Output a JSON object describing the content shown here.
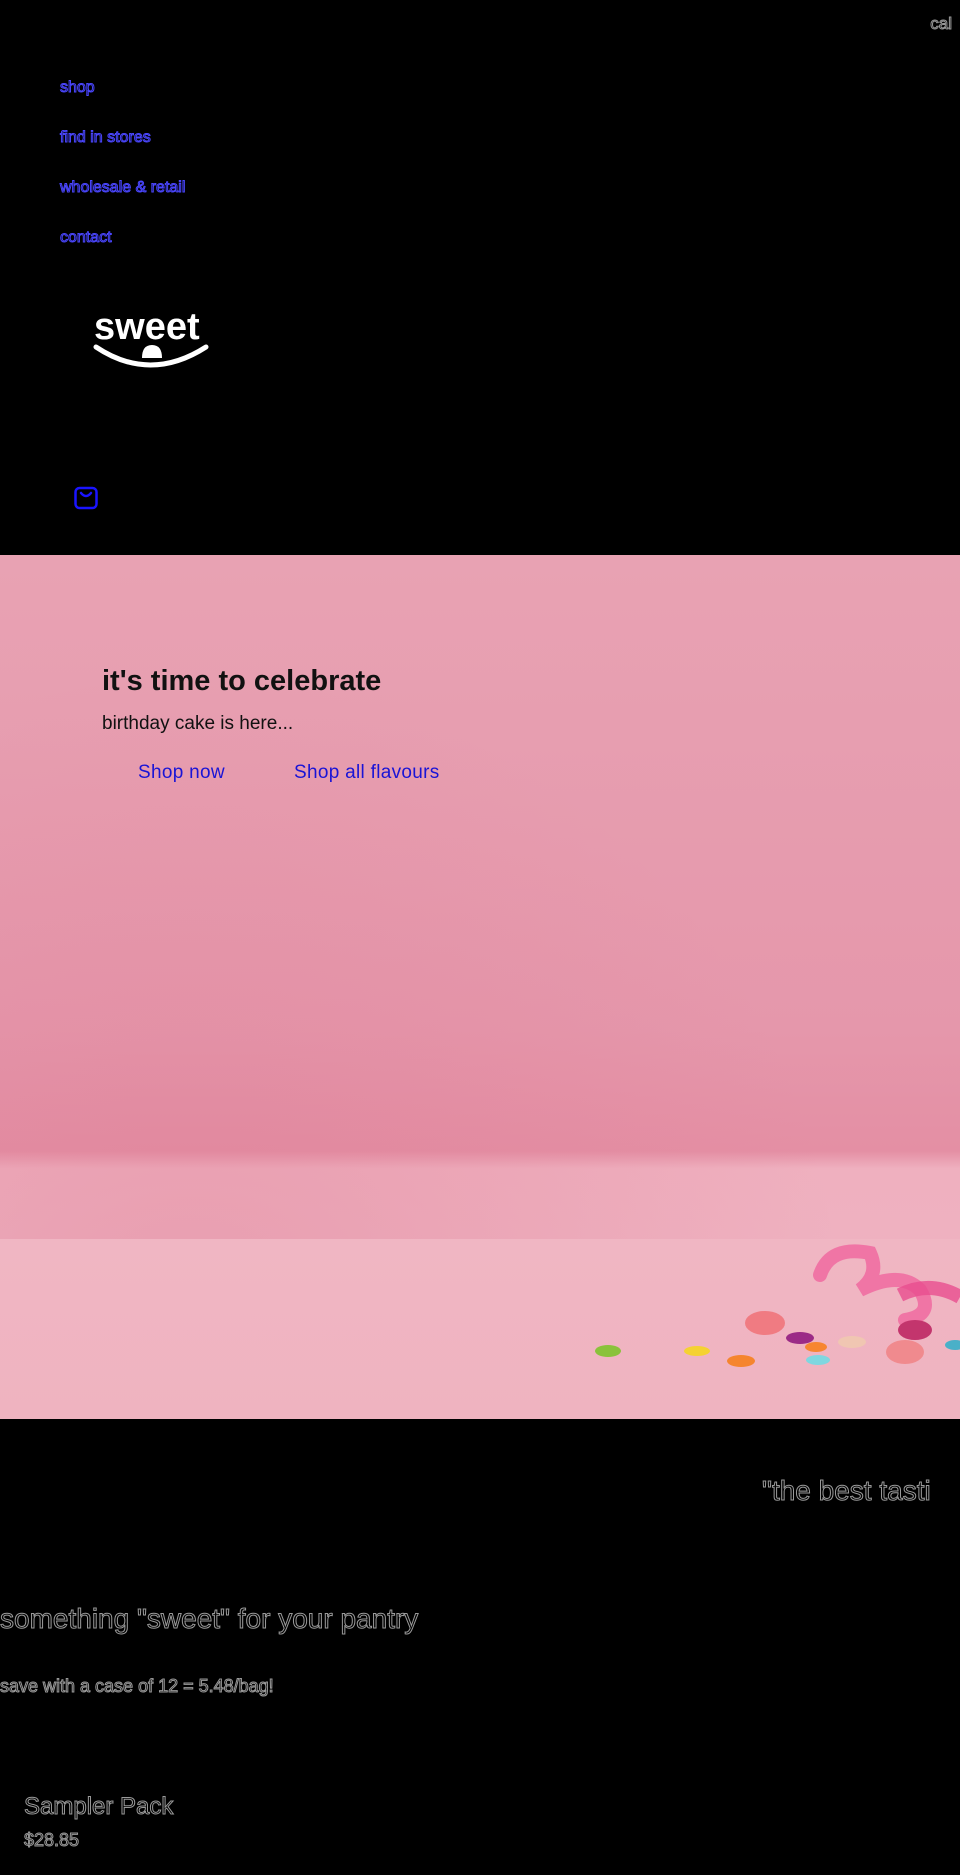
{
  "header": {
    "corner_text": "cal",
    "nav": [
      {
        "label": "shop"
      },
      {
        "label": "find in stores"
      },
      {
        "label": "wholesale & retail"
      },
      {
        "label": "contact"
      }
    ],
    "logo_text": "sweet",
    "cart_icon": "shopping-bag-icon"
  },
  "hero": {
    "title": "it's time to celebrate",
    "subtitle": "birthday cake is here...",
    "buttons": [
      {
        "label": "Shop now"
      },
      {
        "label": "Shop all flavours"
      }
    ]
  },
  "marquee": {
    "text": "\"the best tasti"
  },
  "collection": {
    "heading": "something \"sweet\" for your pantry",
    "subheading": "save with a case of 12 = 5.48/bag!"
  },
  "product": {
    "title": "Sampler Pack",
    "price": "$28.85"
  },
  "colors": {
    "background": "#000000",
    "hero_pink": "#e597ab",
    "link_blue": "#1a14d6",
    "nav_link": "#4a46ff",
    "outline_text": "#9a9a9a"
  }
}
